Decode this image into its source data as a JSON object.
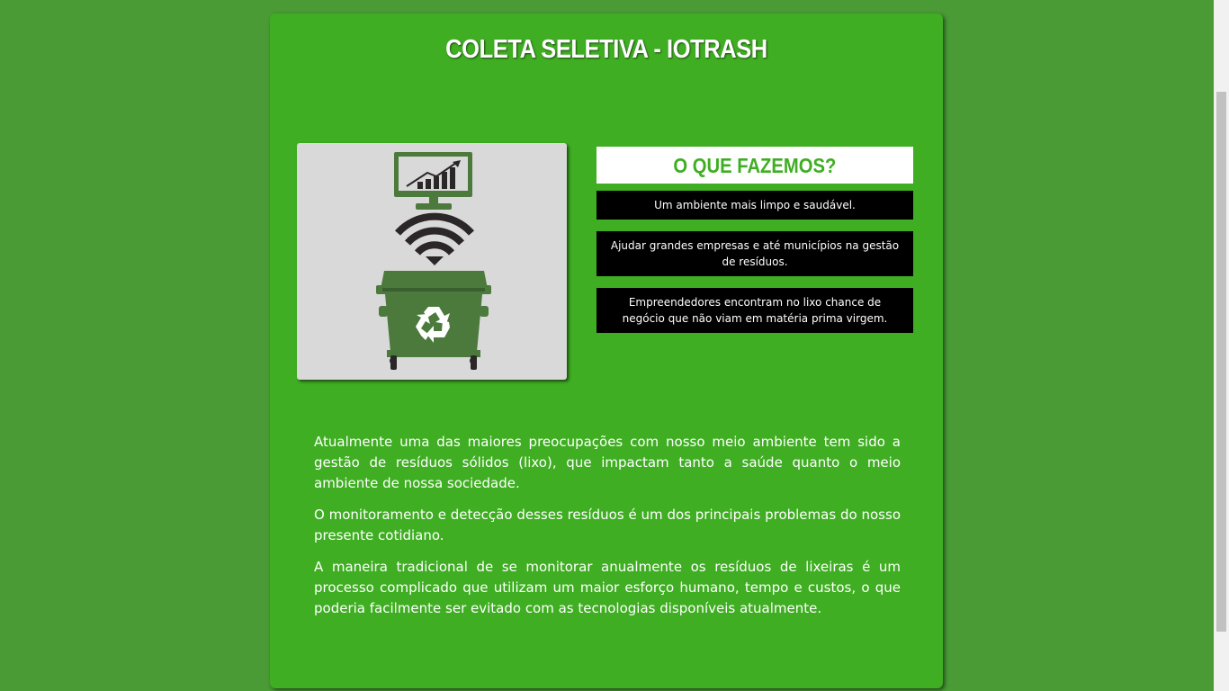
{
  "page": {
    "title": "COLETA SELETIVA - IOTRASH"
  },
  "illustration": {
    "icons": [
      "monitor-chart-icon",
      "wifi-icon",
      "dumpster-recycle-icon"
    ],
    "colors": {
      "background": "#d9d9d9",
      "monitor": "#4b7a3c",
      "wifi": "#2b2628",
      "dumpster": "#4b7a3c"
    }
  },
  "what_we_do": {
    "heading": "O QUE FAZEMOS?",
    "items": [
      "Um ambiente mais limpo e saudável.",
      "Ajudar grandes empresas e até municípios na gestão de resíduos.",
      "Empreendedores encontram no lixo chance de negócio que não viam em matéria prima virgem."
    ]
  },
  "paragraphs": [
    "Atualmente uma das maiores preocupações com nosso meio ambiente tem sido a gestão de resíduos sólidos (lixo), que impactam tanto a saúde quanto o meio ambiente de nossa sociedade.",
    "O monitoramento e detecção desses resíduos é um dos principais problemas do nosso presente cotidiano.",
    "A maneira tradicional de se monitorar anualmente os resíduos de lixeiras é um processo complicado que utilizam um maior esforço humano, tempo e custos, o que poderia facilmente ser evitado com as tecnologias disponíveis atualmente."
  ],
  "colors": {
    "page_background": "#4a9a36",
    "card_background": "#3fae22",
    "heading_accent": "#3fae22",
    "item_background": "#000000"
  }
}
